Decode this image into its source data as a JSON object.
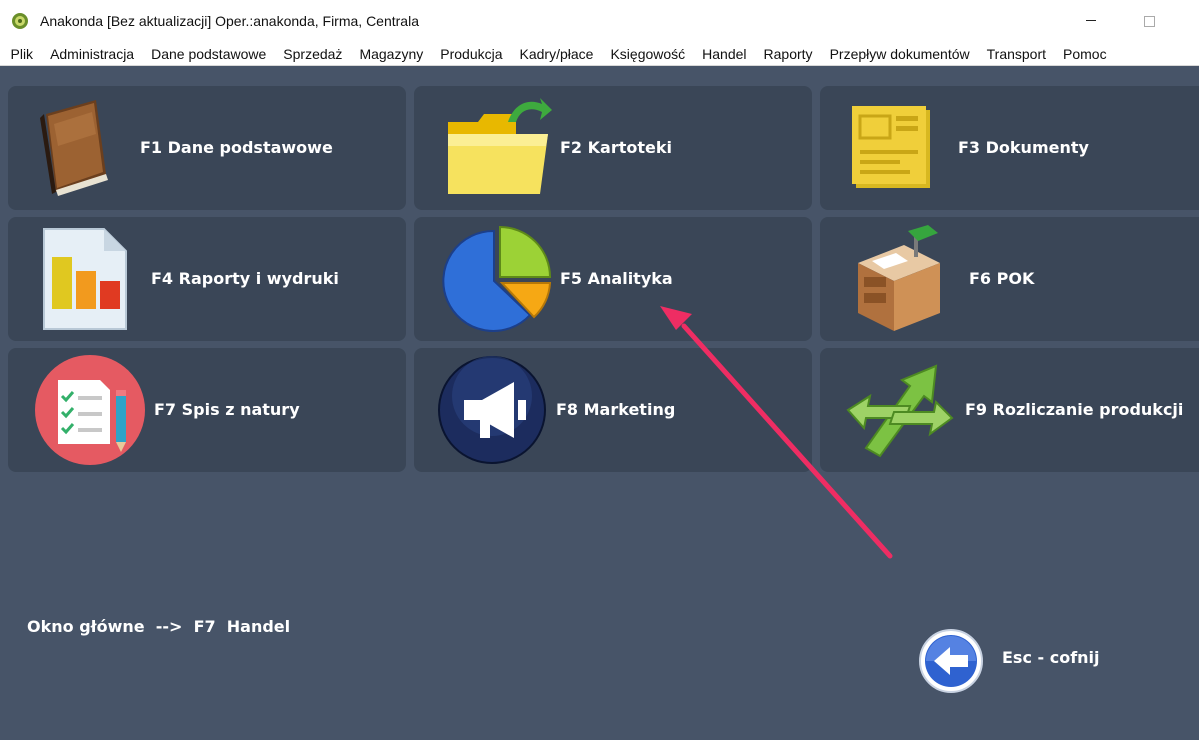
{
  "window": {
    "title": "Anakonda [Bez aktualizacji] Oper.:anakonda, Firma, Centrala"
  },
  "menu": [
    "Plik",
    "Administracja",
    "Dane podstawowe",
    "Sprzedaż",
    "Magazyny",
    "Produkcja",
    "Kadry/płace",
    "Księgowość",
    "Handel",
    "Raporty",
    "Przepływ dokumentów",
    "Transport",
    "Pomoc"
  ],
  "tiles": {
    "f1": {
      "label": "F1  Dane podstawowe",
      "icon": "book-icon"
    },
    "f2": {
      "label": "F2  Kartoteki",
      "icon": "folder-icon"
    },
    "f3": {
      "label": "F3  Dokumenty",
      "icon": "document-icon"
    },
    "f4": {
      "label": "F4  Raporty i wydruki",
      "icon": "bar-report-icon"
    },
    "f5": {
      "label": "F5  Analityka",
      "icon": "pie-chart-icon"
    },
    "f6": {
      "label": "F6  POK",
      "icon": "desk-icon"
    },
    "f7": {
      "label": "F7  Spis z natury",
      "icon": "checklist-icon"
    },
    "f8": {
      "label": "F8  Marketing",
      "icon": "megaphone-icon"
    },
    "f9": {
      "label": "F9  Rozliczanie produkcji",
      "icon": "recycle-arrows-icon"
    }
  },
  "status": {
    "path": "Okno główne  -->  F7  Handel"
  },
  "back": {
    "label": "Esc - cofnij",
    "icon": "back-arrow-icon"
  },
  "colors": {
    "background": "#475468",
    "tile": "#3a4657",
    "annotation_arrow": "#ee2d63"
  }
}
